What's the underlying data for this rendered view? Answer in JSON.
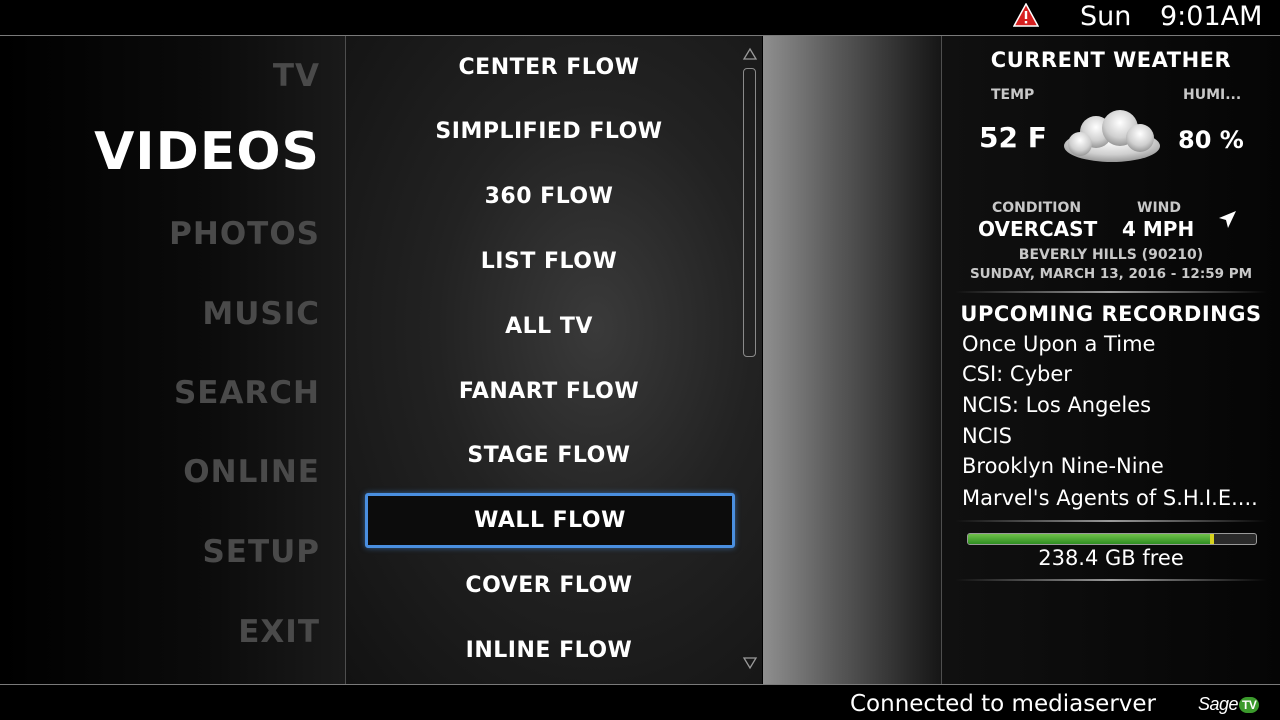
{
  "topbar": {
    "day": "Sun",
    "time": "9:01AM",
    "alert_icon": "warning-triangle-icon",
    "alert_color": "#d62020"
  },
  "left_menu": {
    "items": [
      {
        "label": "TV",
        "selected": false
      },
      {
        "label": "VIDEOS",
        "selected": true
      },
      {
        "label": "PHOTOS",
        "selected": false
      },
      {
        "label": "MUSIC",
        "selected": false
      },
      {
        "label": "SEARCH",
        "selected": false
      },
      {
        "label": "ONLINE",
        "selected": false
      },
      {
        "label": "SETUP",
        "selected": false
      },
      {
        "label": "EXIT",
        "selected": false
      }
    ]
  },
  "center_list": {
    "items": [
      {
        "label": "CENTER FLOW",
        "selected": false
      },
      {
        "label": "SIMPLIFIED FLOW",
        "selected": false
      },
      {
        "label": "360 FLOW",
        "selected": false
      },
      {
        "label": "LIST FLOW",
        "selected": false
      },
      {
        "label": "ALL TV",
        "selected": false
      },
      {
        "label": "FANART FLOW",
        "selected": false
      },
      {
        "label": "STAGE FLOW",
        "selected": false
      },
      {
        "label": "WALL FLOW",
        "selected": true
      },
      {
        "label": "COVER FLOW",
        "selected": false
      },
      {
        "label": "INLINE FLOW",
        "selected": false
      }
    ],
    "selection_color": "#4a8fe0"
  },
  "weather": {
    "title": "CURRENT WEATHER",
    "temp_label": "TEMP",
    "temp_value": "52 F",
    "humidity_label": "HUMI...",
    "humidity_value": "80 %",
    "condition_icon": "cloud-icon",
    "condition_label": "CONDITION",
    "condition_value": "OVERCAST",
    "wind_label": "WIND",
    "wind_value": "4 MPH",
    "wind_icon": "wind-direction-arrow-icon",
    "location": "BEVERLY HILLS (90210)",
    "datetime": "SUNDAY, MARCH 13, 2016 - 12:59 PM"
  },
  "recordings": {
    "title": "UPCOMING RECORDINGS",
    "items": [
      "Once Upon a Time",
      "CSI: Cyber",
      "NCIS: Los Angeles",
      "NCIS",
      "Brooklyn Nine-Nine",
      "Marvel's Agents of S.H.I.E...."
    ]
  },
  "disk": {
    "used_fraction": 0.84,
    "free_text": "238.4 GB free",
    "bar_color": "#3a9a28"
  },
  "footer": {
    "status": "Connected to mediaserver",
    "brand_main": "Sage",
    "brand_badge": "TV",
    "brand_color": "#3b9a2c"
  }
}
